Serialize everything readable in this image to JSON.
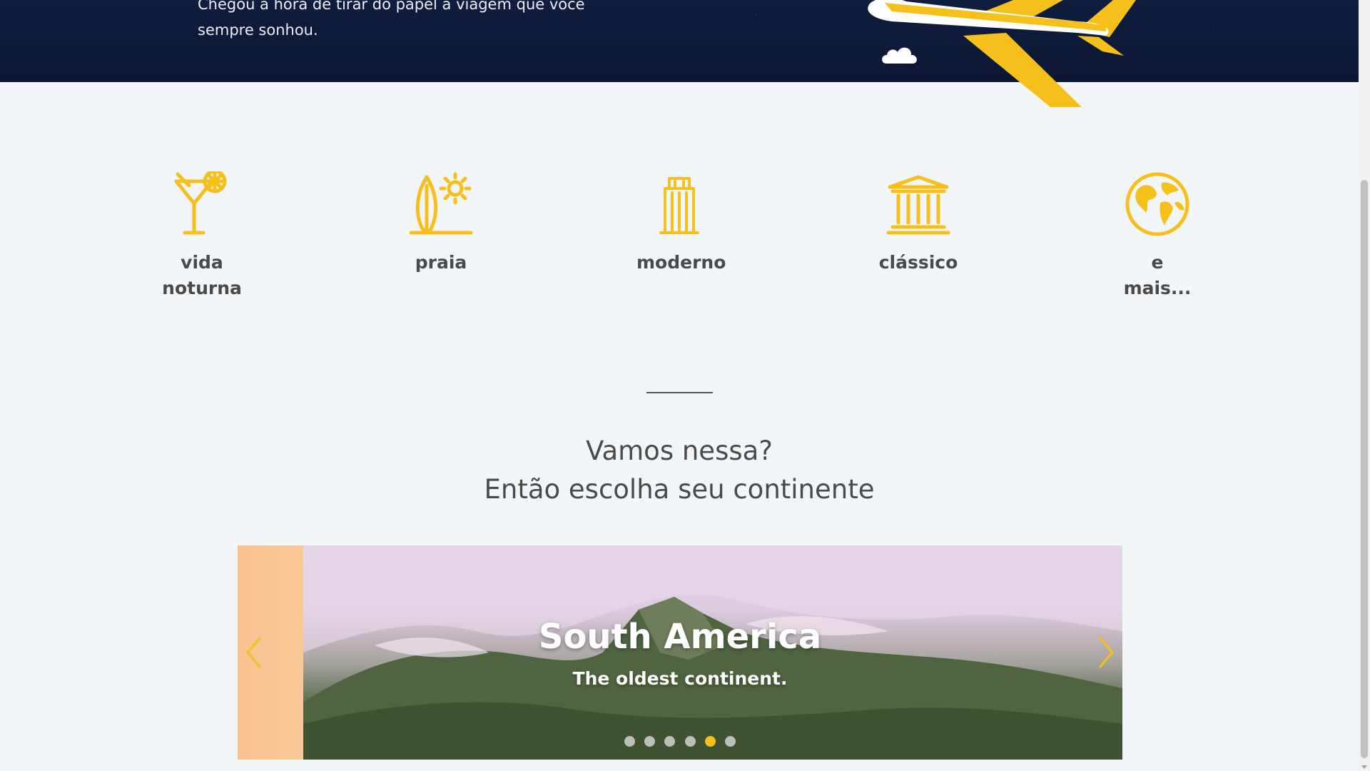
{
  "hero": {
    "text_line_1": "Chegou a hora de tirar do papel a viagem que você",
    "text_line_2": "sempre sonhou.",
    "plane_icon": "airplane-icon",
    "cloud_icon": "cloud-icon"
  },
  "categories": [
    {
      "label": "vida noturna",
      "icon": "cocktail-icon"
    },
    {
      "label": "praia",
      "icon": "surfboard-sun-icon"
    },
    {
      "label": "moderno",
      "icon": "skyscraper-icon"
    },
    {
      "label": "clássico",
      "icon": "temple-icon"
    },
    {
      "label": "e mais...",
      "icon": "globe-icon"
    }
  ],
  "section": {
    "title_line_1": "Vamos nessa?",
    "title_line_2": "Então escolha seu continente"
  },
  "carousel": {
    "title": "South America",
    "subtitle": "The oldest continent.",
    "prev_icon": "chevron-left-icon",
    "next_icon": "chevron-right-icon",
    "dot_count": 6,
    "active_dot": 5
  },
  "colors": {
    "accent": "#f6c01c",
    "hero_bg": "#0d1b3a",
    "page_bg": "#f3f6f8",
    "text": "#4a4a4a"
  }
}
